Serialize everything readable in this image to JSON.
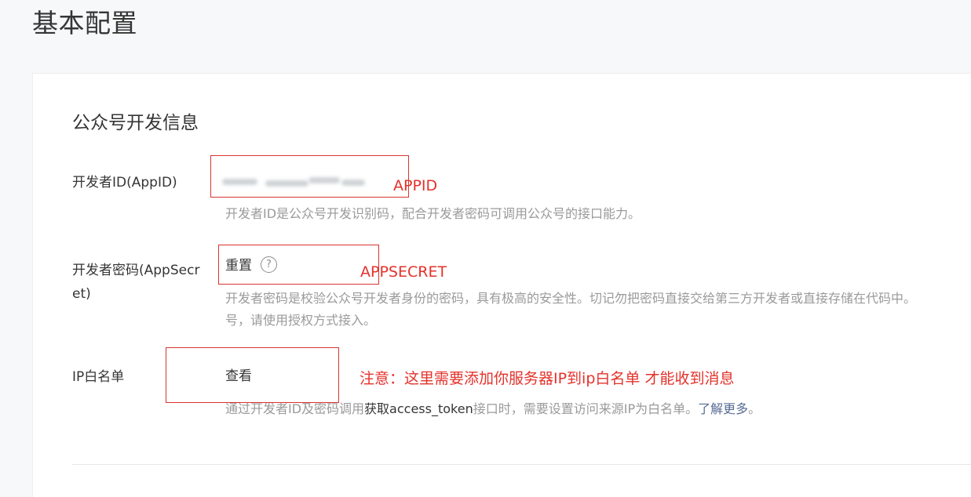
{
  "page": {
    "title": "基本配置"
  },
  "section": {
    "title": "公众号开发信息"
  },
  "appid": {
    "label": "开发者ID(AppID)",
    "value_masked": true,
    "description": "开发者ID是公众号开发识别码，配合开发者密码可调用公众号的接口能力。",
    "annotation": "APPID"
  },
  "secret": {
    "label": "开发者密码(AppSecret)",
    "reset_label": "重置",
    "help_icon": "question-circle-icon",
    "description_line1": "开发者密码是校验公众号开发者身份的密码，具有极高的安全性。切记勿把密码直接交给第三方开发者或直接存储在代码中。",
    "description_line2": "号，请使用授权方式接入。",
    "annotation": "APPSECRET"
  },
  "ip_whitelist": {
    "label": "IP白名单",
    "view_label": "查看",
    "description_prefix": "通过开发者ID及密码调用",
    "description_link": "获取access_token",
    "description_middle": "接口时，需要设置访问来源IP为白名单。",
    "description_more": "了解更多",
    "description_end": "。",
    "annotation": "注意：这里需要添加你服务器IP到ip白名单 才能收到消息"
  },
  "colors": {
    "annotation_red": "#e4322b",
    "box_red": "#d9342f",
    "link_blue": "#576b95",
    "muted_text": "#9a9a9a"
  }
}
